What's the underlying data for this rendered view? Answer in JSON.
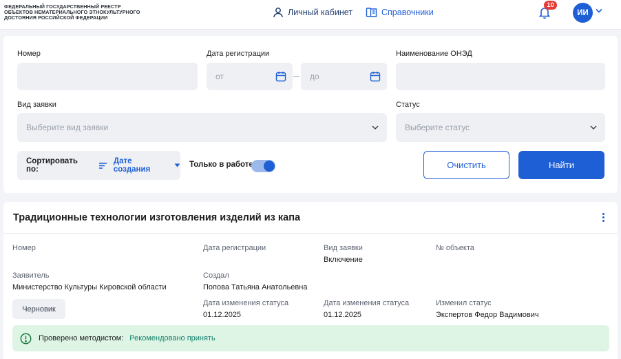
{
  "header": {
    "logo_lines": [
      "ФЕДЕРАЛЬНЫЙ ГОСУДАРСТВЕННЫЙ РЕЕСТР",
      "ОБЪЕКТОВ НЕМАТЕРИАЛЬНОГО ЭТНОКУЛЬТУРНОГО",
      "ДОСТОЯНИЯ РОССИЙСКОЙ ФЕДЕРАЦИИ"
    ],
    "cabinet_label": "Личный кабинет",
    "cabinet_icon": "user-icon",
    "directories_label": "Справочники",
    "directories_icon": "book-icon",
    "notifications_count": "10",
    "avatar_initials": "ИИ"
  },
  "filters": {
    "number_label": "Номер",
    "number_value": "",
    "reg_date_label": "Дата регистрации",
    "date_from_placeholder": "от",
    "date_to_placeholder": "до",
    "oned_name_label": "Наименование ОНЭД",
    "oned_name_value": "",
    "request_type_label": "Вид заявки",
    "request_type_placeholder": "Выберите вид заявки",
    "status_label": "Статус",
    "status_placeholder": "Выберите статус",
    "sort_label": "Сортировать по:",
    "sort_value": "Дате создания",
    "only_in_work_label": "Только в работе",
    "only_in_work_on": true,
    "clear_button": "Очистить",
    "find_button": "Найти"
  },
  "result": {
    "title": "Традиционные технологии изготовления изделий из капа",
    "fields": {
      "number_label": "Номер",
      "number_value": "",
      "reg_date_label": "Дата регистрации",
      "reg_date_value": "",
      "request_type_label": "Вид заявки",
      "request_type_value": "Включение",
      "object_no_label": "№ объекта",
      "object_no_value": "",
      "applicant_label": "Заявитель",
      "applicant_value": "Министерство Культуры Кировской области",
      "created_by_label": "Создал",
      "created_by_value": "Попова Татьяна Анатольевна",
      "status_change_label_1": "Дата изменения статуса",
      "status_change_value_1": "01.12.2025",
      "status_change_label_2": "Дата изменения статуса",
      "status_change_value_2": "01.12.2025",
      "changed_by_label": "Изменил статус",
      "changed_by_value": "Экспертов Федор Вадимович"
    },
    "status_badge": "Черновик",
    "note_label": "Проверено методистом:",
    "note_value": "Рекомендовано принять"
  },
  "colors": {
    "accent": "#1f5fd6",
    "badge_red": "#e53935",
    "note_bg": "#def5e6",
    "note_text": "#13806a"
  }
}
